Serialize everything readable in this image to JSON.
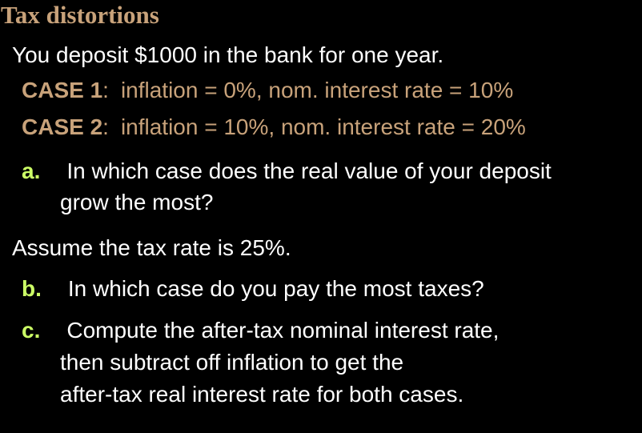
{
  "title": "Tax distortions",
  "intro": "You deposit $1000 in the bank for one year.",
  "cases": [
    {
      "label": "CASE 1",
      "sep": ":",
      "detail": "inflation = 0%, nom. interest rate = 10%"
    },
    {
      "label": "CASE 2",
      "sep": ":",
      "detail": "inflation = 10%, nom. interest rate = 20%"
    }
  ],
  "question_a": {
    "marker": "a.",
    "lines": [
      "In which case does the real value of your deposit",
      "grow the most?"
    ]
  },
  "assumption": "Assume the tax rate is 25%.",
  "question_b": {
    "marker": "b.",
    "lines": [
      "In which case do you pay the most taxes?"
    ]
  },
  "question_c": {
    "marker": "c.",
    "lines": [
      "Compute the after-tax nominal interest rate,",
      "then subtract off inflation to get the",
      "after-tax real interest rate for both cases."
    ]
  },
  "colors": {
    "background": "#000000",
    "title": "#c8a27a",
    "case_text": "#c8a27a",
    "body_text": "#ffffff",
    "list_marker": "#ccff66"
  }
}
